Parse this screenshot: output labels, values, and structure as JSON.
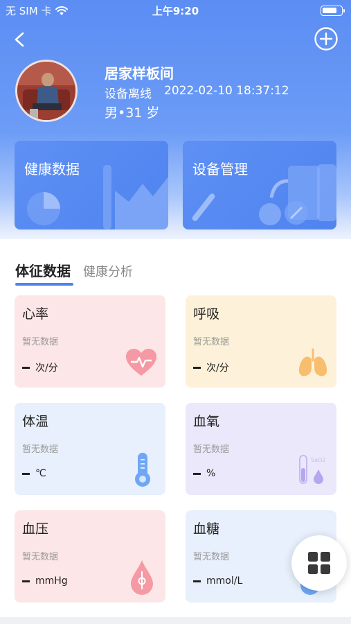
{
  "status_bar": {
    "carrier": "无 SIM 卡",
    "time": "上午9:20",
    "battery_level": 0.8
  },
  "colors": {
    "brand_blue": "#4f83ef",
    "card_heart": "#fde6e7",
    "card_breath": "#fdf2d9",
    "card_temp": "#e7f0fc",
    "card_spo2": "#ebe8fb",
    "card_bp": "#fde6e7",
    "card_glucose": "#e7f0fc"
  },
  "profile": {
    "name": "居家样板间",
    "device_status": "设备离线",
    "timestamp": "2022-02-10 18:37:12",
    "gender_age": "男•31 岁"
  },
  "shortcuts": [
    {
      "label": "健康数据",
      "icon": "chart-illustration"
    },
    {
      "label": "设备管理",
      "icon": "device-illustration"
    }
  ],
  "tabs": [
    {
      "label": "体征数据",
      "active": true
    },
    {
      "label": "健康分析",
      "active": false
    }
  ],
  "vitals": [
    {
      "name": "心率",
      "status": "暂无数据",
      "unit": "次/分",
      "icon": "heart-icon"
    },
    {
      "name": "呼吸",
      "status": "暂无数据",
      "unit": "次/分",
      "icon": "lungs-icon"
    },
    {
      "name": "体温",
      "status": "暂无数据",
      "unit": "℃",
      "icon": "thermometer-icon"
    },
    {
      "name": "血氧",
      "status": "暂无数据",
      "unit": "%",
      "icon": "spo2-icon",
      "icon_text": "SaO2"
    },
    {
      "name": "血压",
      "status": "暂无数据",
      "unit": "mmHg",
      "icon": "blood-drop-icon"
    },
    {
      "name": "血糖",
      "status": "暂无数据",
      "unit": "mmol/L",
      "icon": "glucose-icon"
    }
  ]
}
